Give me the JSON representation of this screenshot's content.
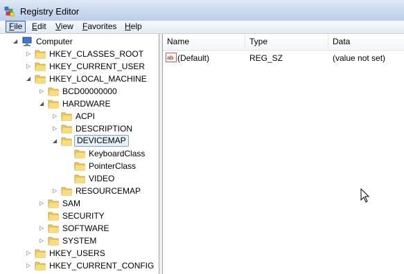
{
  "window": {
    "title": "Registry Editor"
  },
  "menu": [
    {
      "label_u": "F",
      "label_rest": "ile"
    },
    {
      "label_u": "E",
      "label_rest": "dit"
    },
    {
      "label_u": "V",
      "label_rest": "iew"
    },
    {
      "label_u": "F",
      "label_rest": "avorites"
    },
    {
      "label_u": "H",
      "label_rest": "elp"
    }
  ],
  "tree": {
    "root": "Computer",
    "nodes": [
      {
        "label": "HKEY_CLASSES_ROOT",
        "expander": "▷"
      },
      {
        "label": "HKEY_CURRENT_USER",
        "expander": "▷"
      },
      {
        "label": "HKEY_LOCAL_MACHINE",
        "expander": "◢"
      },
      {
        "label": "BCD00000000",
        "expander": "▷"
      },
      {
        "label": "HARDWARE",
        "expander": "◢"
      },
      {
        "label": "ACPI",
        "expander": "▷"
      },
      {
        "label": "DESCRIPTION",
        "expander": "▷"
      },
      {
        "label": "DEVICEMAP",
        "expander": "◢"
      },
      {
        "label": "KeyboardClass",
        "expander": ""
      },
      {
        "label": "PointerClass",
        "expander": ""
      },
      {
        "label": "VIDEO",
        "expander": ""
      },
      {
        "label": "RESOURCEMAP",
        "expander": "▷"
      },
      {
        "label": "SAM",
        "expander": "▷"
      },
      {
        "label": "SECURITY",
        "expander": ""
      },
      {
        "label": "SOFTWARE",
        "expander": "▷"
      },
      {
        "label": "SYSTEM",
        "expander": "▷"
      },
      {
        "label": "HKEY_USERS",
        "expander": "▷"
      },
      {
        "label": "HKEY_CURRENT_CONFIG",
        "expander": "▷"
      }
    ]
  },
  "list": {
    "columns": [
      "Name",
      "Type",
      "Data"
    ],
    "rows": [
      {
        "name": "(Default)",
        "type": "REG_SZ",
        "data": "(value not set)",
        "icon": "string-value-icon"
      }
    ]
  },
  "colors": {
    "folder": "#f2c94c",
    "selection": "#e5f1fb",
    "titlebar": "#c9d9ee"
  }
}
